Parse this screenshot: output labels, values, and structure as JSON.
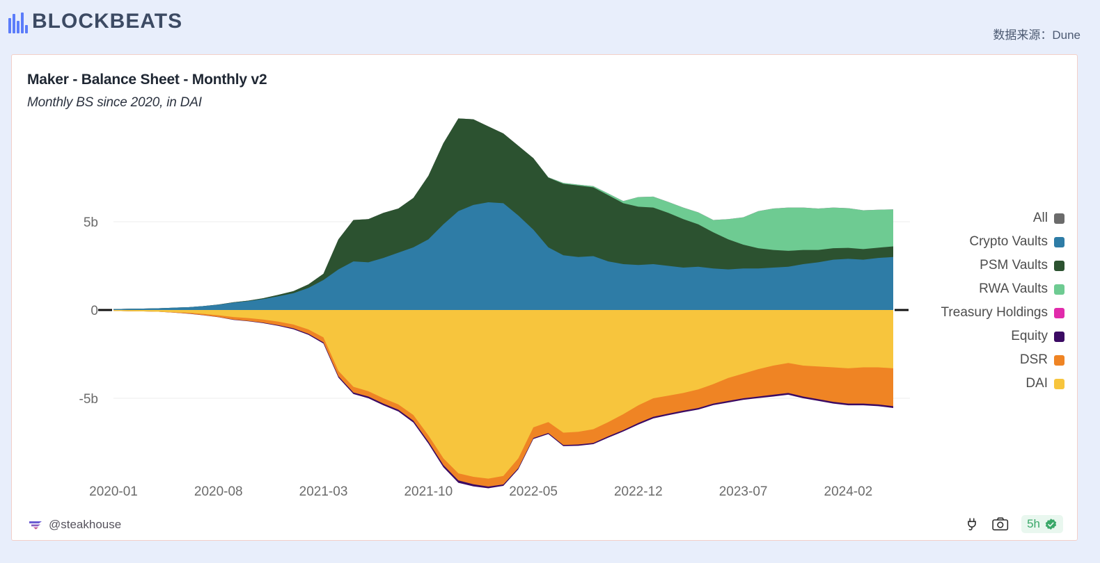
{
  "header": {
    "logo_text": "BLOCKBEATS",
    "logo_icon": "bar-logo-icon",
    "source_text": "数据来源：Dune"
  },
  "card": {
    "title": "Maker - Balance Sheet - Monthly v2",
    "subtitle": "Monthly BS since 2020, in DAI"
  },
  "legend": {
    "items": [
      {
        "label": "All",
        "color": "#6b6b6b"
      },
      {
        "label": "Crypto Vaults",
        "color": "#2e7ca6"
      },
      {
        "label": "PSM Vaults",
        "color": "#2c5230"
      },
      {
        "label": "RWA Vaults",
        "color": "#6ecb92"
      },
      {
        "label": "Treasury Holdings",
        "color": "#e12bab"
      },
      {
        "label": "Equity",
        "color": "#3b0a63"
      },
      {
        "label": "DSR",
        "color": "#ef8424"
      },
      {
        "label": "DAI",
        "color": "#f7c53d"
      }
    ]
  },
  "footer": {
    "author_icon": "dune-wing-icon",
    "author": "@steakhouse",
    "plug_icon": "plug-icon",
    "camera_icon": "camera-icon",
    "freshness": "5h",
    "freshness_icon": "verified-check-icon"
  },
  "chart_data": {
    "type": "area",
    "title": "Maker - Balance Sheet - Monthly v2",
    "subtitle": "Monthly BS since 2020, in DAI",
    "xlabel": "",
    "ylabel": "",
    "unit": "DAI",
    "stacked": true,
    "diverging": true,
    "grid": true,
    "legend_position": "right",
    "ylim": [
      -10.5,
      10.5
    ],
    "ytick_labels": [
      "5b",
      "0",
      "-5b"
    ],
    "yticks": [
      5,
      0,
      -5
    ],
    "xtick_labels": [
      "2020-01",
      "2020-08",
      "2021-03",
      "2021-10",
      "2022-05",
      "2022-12",
      "2023-07",
      "2024-02"
    ],
    "x": [
      "2020-01",
      "2020-02",
      "2020-03",
      "2020-04",
      "2020-05",
      "2020-06",
      "2020-07",
      "2020-08",
      "2020-09",
      "2020-10",
      "2020-11",
      "2020-12",
      "2021-01",
      "2021-02",
      "2021-03",
      "2021-04",
      "2021-05",
      "2021-06",
      "2021-07",
      "2021-08",
      "2021-09",
      "2021-10",
      "2021-11",
      "2021-12",
      "2022-01",
      "2022-02",
      "2022-03",
      "2022-04",
      "2022-05",
      "2022-06",
      "2022-07",
      "2022-08",
      "2022-09",
      "2022-10",
      "2022-11",
      "2022-12",
      "2023-01",
      "2023-02",
      "2023-03",
      "2023-04",
      "2023-05",
      "2023-06",
      "2023-07",
      "2023-08",
      "2023-09",
      "2023-10",
      "2023-11",
      "2023-12",
      "2024-01",
      "2024-02",
      "2024-03",
      "2024-04",
      "2024-05"
    ],
    "series": [
      {
        "name": "Crypto Vaults",
        "color": "#2e7ca6",
        "side": "assets",
        "values": [
          0.05,
          0.07,
          0.08,
          0.1,
          0.13,
          0.16,
          0.22,
          0.3,
          0.42,
          0.5,
          0.62,
          0.78,
          0.95,
          1.25,
          1.7,
          2.3,
          2.75,
          2.7,
          2.95,
          3.25,
          3.55,
          4.0,
          4.85,
          5.6,
          5.95,
          6.1,
          6.05,
          5.35,
          4.55,
          3.55,
          3.1,
          3.0,
          3.05,
          2.75,
          2.6,
          2.55,
          2.6,
          2.5,
          2.4,
          2.45,
          2.35,
          2.3,
          2.35,
          2.35,
          2.4,
          2.45,
          2.6,
          2.7,
          2.85,
          2.9,
          2.85,
          2.95,
          3.0
        ]
      },
      {
        "name": "PSM Vaults",
        "color": "#2c5230",
        "side": "assets",
        "values": [
          0.0,
          0.0,
          0.0,
          0.0,
          0.0,
          0.0,
          0.0,
          0.01,
          0.02,
          0.03,
          0.05,
          0.08,
          0.12,
          0.2,
          0.35,
          1.7,
          2.35,
          2.45,
          2.55,
          2.5,
          2.8,
          3.6,
          4.6,
          5.25,
          4.85,
          4.3,
          3.95,
          3.95,
          4.05,
          3.95,
          4.05,
          4.05,
          3.9,
          3.75,
          3.45,
          3.3,
          3.2,
          3.0,
          2.75,
          2.4,
          2.05,
          1.7,
          1.35,
          1.15,
          1.0,
          0.9,
          0.8,
          0.7,
          0.65,
          0.62,
          0.6,
          0.58,
          0.6
        ]
      },
      {
        "name": "RWA Vaults",
        "color": "#6ecb92",
        "side": "assets",
        "values": [
          0.0,
          0.0,
          0.0,
          0.0,
          0.0,
          0.0,
          0.0,
          0.0,
          0.0,
          0.0,
          0.0,
          0.0,
          0.0,
          0.0,
          0.0,
          0.0,
          0.0,
          0.0,
          0.0,
          0.0,
          0.0,
          0.0,
          0.0,
          0.0,
          0.0,
          0.0,
          0.0,
          0.0,
          0.0,
          0.02,
          0.05,
          0.05,
          0.07,
          0.1,
          0.12,
          0.55,
          0.62,
          0.62,
          0.65,
          0.68,
          0.7,
          1.15,
          1.55,
          2.1,
          2.35,
          2.45,
          2.4,
          2.35,
          2.3,
          2.25,
          2.2,
          2.15,
          2.1
        ]
      },
      {
        "name": "Treasury Holdings",
        "color": "#e12bab",
        "side": "assets",
        "values": [
          0,
          0,
          0,
          0,
          0,
          0,
          0,
          0,
          0,
          0,
          0,
          0,
          0,
          0,
          0,
          0,
          0,
          0,
          0,
          0,
          0,
          0,
          0,
          0,
          0,
          0,
          0,
          0,
          0,
          0,
          0,
          0,
          0,
          0,
          0,
          0,
          0,
          0,
          0,
          0,
          0,
          0,
          0,
          0,
          0,
          0,
          0,
          0,
          0,
          0,
          0,
          0,
          0
        ]
      },
      {
        "name": "DAI",
        "color": "#f7c53d",
        "side": "liabilities",
        "values": [
          -0.05,
          -0.07,
          -0.08,
          -0.1,
          -0.13,
          -0.16,
          -0.22,
          -0.3,
          -0.4,
          -0.46,
          -0.54,
          -0.66,
          -0.82,
          -1.1,
          -1.55,
          -3.45,
          -4.35,
          -4.6,
          -5.0,
          -5.35,
          -5.95,
          -7.1,
          -8.4,
          -9.25,
          -9.45,
          -9.55,
          -9.4,
          -8.4,
          -6.65,
          -6.35,
          -6.95,
          -6.9,
          -6.75,
          -6.35,
          -5.9,
          -5.4,
          -5.0,
          -4.85,
          -4.7,
          -4.5,
          -4.2,
          -3.85,
          -3.6,
          -3.35,
          -3.15,
          -3.0,
          -3.15,
          -3.2,
          -3.25,
          -3.3,
          -3.25,
          -3.25,
          -3.3
        ]
      },
      {
        "name": "DSR",
        "color": "#ef8424",
        "side": "liabilities",
        "values": [
          0.0,
          0.0,
          0.0,
          0.0,
          -0.02,
          -0.04,
          -0.07,
          -0.1,
          -0.14,
          -0.16,
          -0.18,
          -0.2,
          -0.22,
          -0.25,
          -0.28,
          -0.3,
          -0.32,
          -0.3,
          -0.3,
          -0.3,
          -0.32,
          -0.35,
          -0.38,
          -0.4,
          -0.42,
          -0.45,
          -0.48,
          -0.55,
          -0.6,
          -0.62,
          -0.7,
          -0.72,
          -0.78,
          -0.8,
          -0.9,
          -1.0,
          -1.05,
          -1.02,
          -1.0,
          -1.05,
          -1.1,
          -1.3,
          -1.4,
          -1.55,
          -1.65,
          -1.7,
          -1.75,
          -1.85,
          -1.95,
          -2.0,
          -2.05,
          -2.1,
          -2.15
        ]
      },
      {
        "name": "Equity",
        "color": "#3b0a63",
        "side": "liabilities",
        "values": [
          0.0,
          0.0,
          0.0,
          0.0,
          0.0,
          -0.01,
          -0.01,
          -0.01,
          -0.02,
          -0.02,
          -0.03,
          -0.04,
          -0.05,
          -0.06,
          -0.07,
          -0.08,
          -0.09,
          -0.1,
          -0.1,
          -0.1,
          -0.11,
          -0.12,
          -0.13,
          -0.14,
          -0.12,
          -0.1,
          -0.08,
          -0.07,
          -0.06,
          -0.06,
          -0.06,
          -0.07,
          -0.07,
          -0.08,
          -0.08,
          -0.09,
          -0.09,
          -0.09,
          -0.09,
          -0.09,
          -0.09,
          -0.09,
          -0.09,
          -0.09,
          -0.1,
          -0.1,
          -0.1,
          -0.1,
          -0.1,
          -0.1,
          -0.1,
          -0.1,
          -0.1
        ]
      }
    ]
  }
}
